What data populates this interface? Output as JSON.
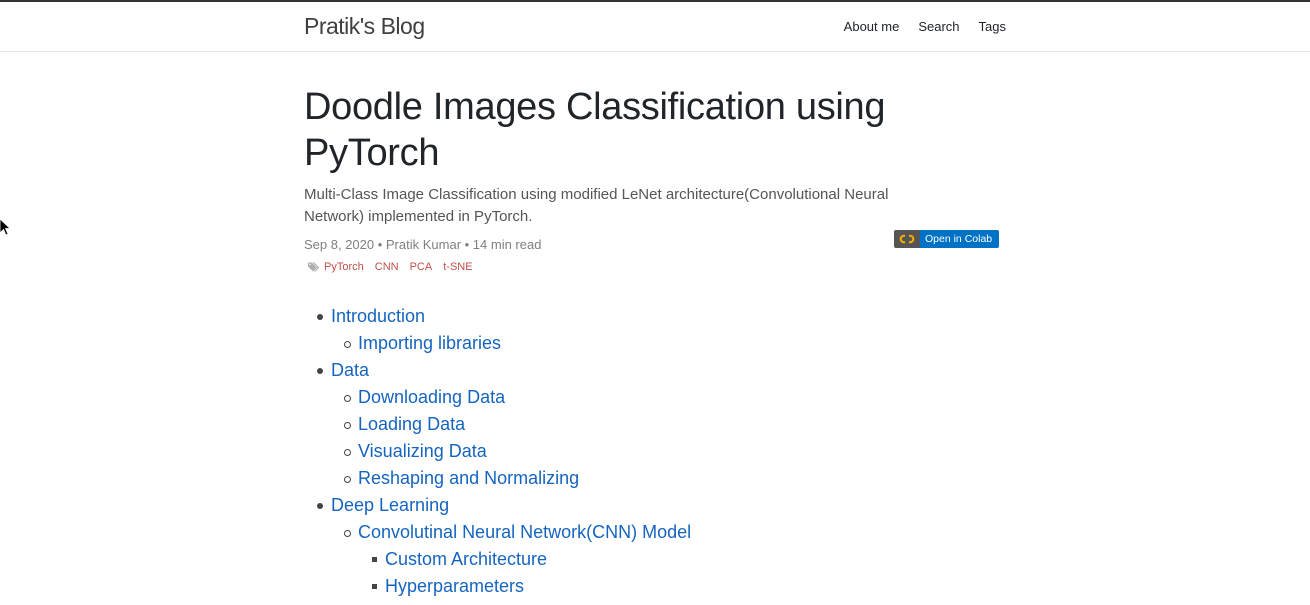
{
  "nav": {
    "brand": "Pratik's Blog",
    "links": [
      "About me",
      "Search",
      "Tags"
    ]
  },
  "post": {
    "title": "Doodle Images Classification using PyTorch",
    "description": "Multi-Class Image Classification using modified LeNet architecture(Convolutional Neural Network) implemented in PyTorch.",
    "meta": "Sep 8, 2020 • Pratik Kumar • 14 min read",
    "tags": [
      "PyTorch",
      "CNN",
      "PCA",
      "t-SNE"
    ],
    "tag_color": "#c0504d",
    "colab_badge": "Open in Colab",
    "colab_icon": "colab-logo-icon"
  },
  "toc": [
    {
      "label": "Introduction",
      "level": 1
    },
    {
      "label": "Importing libraries",
      "level": 2
    },
    {
      "label": "Data",
      "level": 1
    },
    {
      "label": "Downloading Data",
      "level": 2
    },
    {
      "label": "Loading Data",
      "level": 2
    },
    {
      "label": "Visualizing Data",
      "level": 2
    },
    {
      "label": "Reshaping and Normalizing",
      "level": 2
    },
    {
      "label": "Deep Learning",
      "level": 1
    },
    {
      "label": "Convolutinal Neural Network(CNN) Model",
      "level": 2
    },
    {
      "label": "Custom Architecture",
      "level": 3
    },
    {
      "label": "Hyperparameters",
      "level": 3
    }
  ],
  "link_color": "#1565c0"
}
